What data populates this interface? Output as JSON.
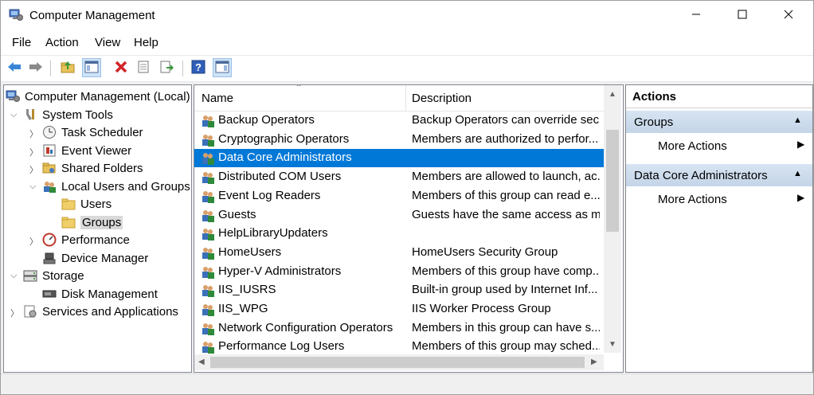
{
  "window": {
    "title": "Computer Management",
    "controls": {
      "minimize": "minimize",
      "maximize": "maximize",
      "close": "close"
    }
  },
  "menu": [
    "File",
    "Action",
    "View",
    "Help"
  ],
  "toolbar": [
    "back-icon",
    "forward-icon",
    "up-folder-icon",
    "show-hide-tree-icon",
    "delete-icon",
    "properties-icon",
    "export-list-icon",
    "help-icon",
    "show-hide-action-pane-icon"
  ],
  "tree": {
    "root": "Computer Management (Local)",
    "system_tools": "System Tools",
    "task_scheduler": "Task Scheduler",
    "event_viewer": "Event Viewer",
    "shared_folders": "Shared Folders",
    "local_users_groups": "Local Users and Groups",
    "users": "Users",
    "groups": "Groups",
    "performance": "Performance",
    "device_manager": "Device Manager",
    "storage": "Storage",
    "disk_management": "Disk Management",
    "services_apps": "Services and Applications"
  },
  "list": {
    "columns": {
      "name": "Name",
      "description": "Description"
    },
    "rows": [
      {
        "name": "Backup Operators",
        "description": "Backup Operators can override sec..."
      },
      {
        "name": "Cryptographic Operators",
        "description": "Members are authorized to perfor..."
      },
      {
        "name": "Data Core Administrators",
        "description": ""
      },
      {
        "name": "Distributed COM Users",
        "description": "Members are allowed to launch, ac..."
      },
      {
        "name": "Event Log Readers",
        "description": "Members of this group can read e..."
      },
      {
        "name": "Guests",
        "description": "Guests have the same access as m..."
      },
      {
        "name": "HelpLibraryUpdaters",
        "description": ""
      },
      {
        "name": "HomeUsers",
        "description": "HomeUsers Security Group"
      },
      {
        "name": "Hyper-V Administrators",
        "description": "Members of this group have comp..."
      },
      {
        "name": "IIS_IUSRS",
        "description": "Built-in group used by Internet Inf..."
      },
      {
        "name": "IIS_WPG",
        "description": "IIS Worker Process Group"
      },
      {
        "name": "Network Configuration Operators",
        "description": "Members in this group can have s..."
      },
      {
        "name": "Performance Log Users",
        "description": "Members of this group may sched..."
      }
    ],
    "selected_index": 2
  },
  "actions": {
    "header": "Actions",
    "section1": "Groups",
    "more1": "More Actions",
    "section2": "Data Core Administrators",
    "more2": "More Actions"
  },
  "colors": {
    "selection": "#0078d7",
    "actions_section": "#c9d9ea"
  }
}
